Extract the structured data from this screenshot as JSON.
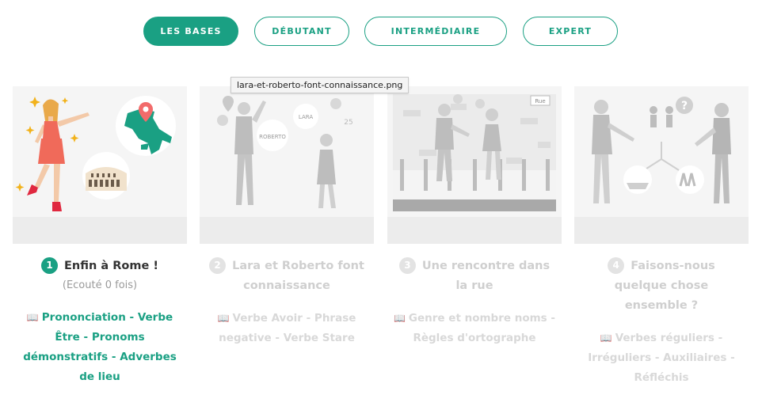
{
  "tabs": [
    {
      "label": "LES BASES",
      "active": true
    },
    {
      "label": "DÉBUTANT",
      "active": false
    },
    {
      "label": "INTERMÉDIAIRE",
      "active": false
    },
    {
      "label": "EXPERT",
      "active": false
    }
  ],
  "tooltip": "lara-et-roberto-font-connaissance.png",
  "lessons": [
    {
      "number": "1",
      "title": "Enfin à Rome !",
      "subtitle": "(Ecouté 0 fois)",
      "topics": "Prononciation - Verbe Être - Pronoms démonstratifs - Adverbes de lieu",
      "active": true
    },
    {
      "number": "2",
      "title": "Lara et Roberto font connaissance",
      "topics": "Verbe Avoir - Phrase negative - Verbe Stare",
      "bubble_left": "ROBERTO",
      "bubble_right": "LARA",
      "bubble_age": "25"
    },
    {
      "number": "3",
      "title": "Une rencontre dans la rue",
      "topics": "Genre et nombre noms - Règles d'ortographe",
      "sign": "Rue"
    },
    {
      "number": "4",
      "title": "Faisons-nous quelque chose ensemble ?",
      "topics": "Verbes réguliers - Irréguliers - Auxiliaires - Réfléchis"
    }
  ],
  "icons": {
    "book": "book-icon"
  },
  "colors": {
    "accent": "#1aa083",
    "inactive_text": "#cfcfcf",
    "pin": "#f26b6b",
    "dress": "#f06a5a"
  }
}
